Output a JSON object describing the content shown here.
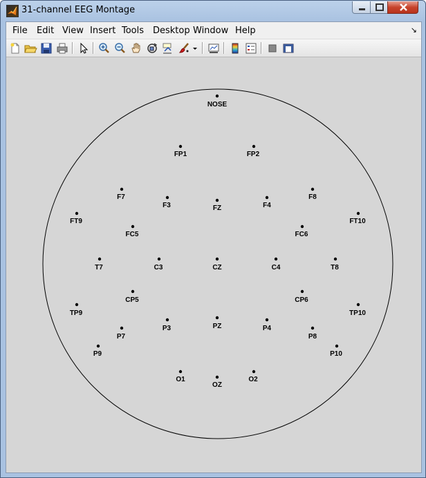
{
  "window": {
    "title": "31-channel EEG Montage"
  },
  "menubar": {
    "items": [
      "File",
      "Edit",
      "View",
      "Insert",
      "Tools",
      "Desktop",
      "Window",
      "Help"
    ],
    "dock_glyph": "↘"
  },
  "toolbar": {
    "buttons": [
      "new-figure-icon",
      "open-file-icon",
      "save-icon",
      "print-icon",
      "edit-plot-arrow-icon",
      "zoom-in-icon",
      "zoom-out-icon",
      "pan-hand-icon",
      "rotate-3d-icon",
      "data-cursor-icon",
      "brush-icon",
      "brush-dropdown-icon",
      "link-plot-icon",
      "insert-colorbar-icon",
      "insert-legend-icon",
      "hide-plot-tools-icon",
      "show-plot-tools-icon"
    ]
  },
  "montage": {
    "nose_label": "NOSE",
    "electrodes": [
      {
        "label": "FP1"
      },
      {
        "label": "FP2"
      },
      {
        "label": "F7"
      },
      {
        "label": "F3"
      },
      {
        "label": "FZ"
      },
      {
        "label": "F4"
      },
      {
        "label": "F8"
      },
      {
        "label": "FT9"
      },
      {
        "label": "FC5"
      },
      {
        "label": "FC6"
      },
      {
        "label": "FT10"
      },
      {
        "label": "T7"
      },
      {
        "label": "C3"
      },
      {
        "label": "CZ"
      },
      {
        "label": "C4"
      },
      {
        "label": "T8"
      },
      {
        "label": "CP5"
      },
      {
        "label": "CP6"
      },
      {
        "label": "TP9"
      },
      {
        "label": "TP10"
      },
      {
        "label": "P7"
      },
      {
        "label": "P3"
      },
      {
        "label": "PZ"
      },
      {
        "label": "P4"
      },
      {
        "label": "P8"
      },
      {
        "label": "P9"
      },
      {
        "label": "P10"
      },
      {
        "label": "O1"
      },
      {
        "label": "OZ"
      },
      {
        "label": "O2"
      }
    ]
  }
}
